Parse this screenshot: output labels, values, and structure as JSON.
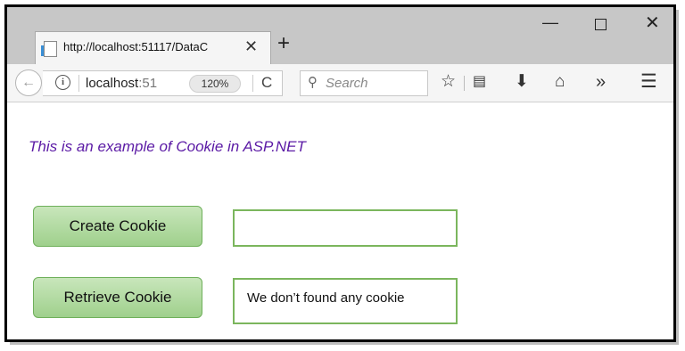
{
  "browser": {
    "tab_title": "http://localhost:51117/DataC",
    "new_tab_label": "+",
    "address": {
      "host": "localhost",
      "port_fragment": ":51"
    },
    "zoom_level": "120%",
    "search_placeholder": "Search",
    "icons": {
      "back": "back-arrow-icon",
      "info": "info-icon",
      "reload": "reload-icon",
      "search": "search-icon",
      "bookmark": "star-icon",
      "reading_list": "reading-list-icon",
      "download": "download-icon",
      "home": "home-icon",
      "overflow": "overflow-chevrons-icon",
      "menu": "hamburger-menu-icon"
    }
  },
  "page": {
    "heading": "This is an example of Cookie in ASP.NET",
    "create_button": "Create Cookie",
    "retrieve_button": "Retrieve Cookie",
    "create_field_value": "",
    "retrieve_field_value": "We don’t found any cookie"
  },
  "colors": {
    "heading": "#5b1aa5",
    "button_fill": "#9fd08c",
    "field_border": "#7bb65d"
  }
}
